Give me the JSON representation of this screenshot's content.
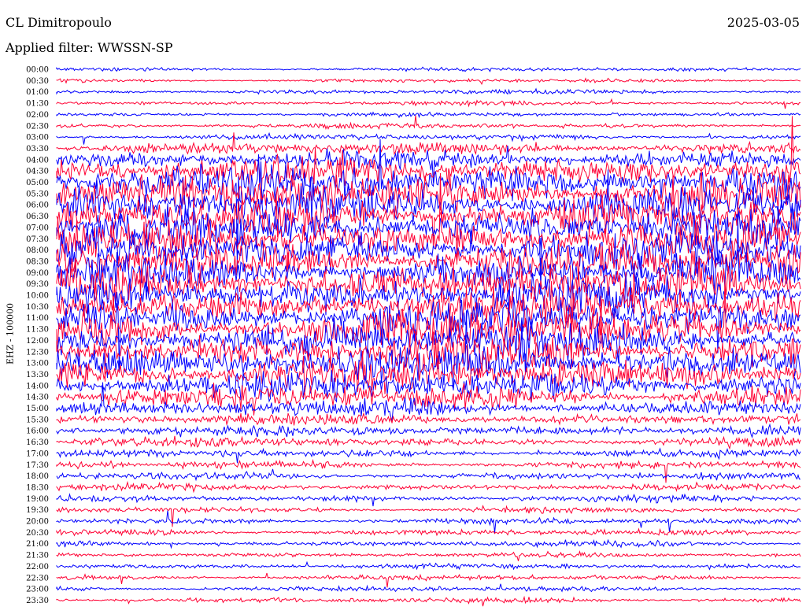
{
  "header": {
    "station": "CL Dimitropoulo",
    "date": "2025-03-05",
    "filter_label": "Applied filter: WWSSN-SP"
  },
  "chart_data": {
    "type": "helicorder",
    "title": "CL Dimitropoulo",
    "date": "2025-03-05",
    "filter": "WWSSN-SP",
    "ylabel": "EHZ - 100000",
    "row_labels": [
      "00:00",
      "00:30",
      "01:00",
      "01:30",
      "02:00",
      "02:30",
      "03:00",
      "03:30",
      "04:00",
      "04:30",
      "05:00",
      "05:30",
      "06:00",
      "06:30",
      "07:00",
      "07:30",
      "08:00",
      "08:30",
      "09:00",
      "09:30",
      "10:00",
      "10:30",
      "11:00",
      "11:30",
      "12:00",
      "12:30",
      "13:00",
      "13:30",
      "14:00",
      "14:30",
      "15:00",
      "15:30",
      "16:00",
      "16:30",
      "17:00",
      "17:30",
      "18:00",
      "18:30",
      "19:00",
      "19:30",
      "20:00",
      "20:30",
      "21:00",
      "21:30",
      "22:00",
      "22:30",
      "23:00",
      "23:30"
    ],
    "trace_colors": [
      "#0000ff",
      "#ff0033"
    ],
    "relative_amplitude": [
      0.25,
      0.25,
      0.3,
      0.3,
      0.3,
      0.35,
      0.4,
      0.8,
      1.2,
      2.0,
      2.5,
      2.6,
      2.6,
      2.6,
      2.6,
      2.6,
      2.6,
      2.6,
      2.6,
      2.6,
      2.6,
      2.6,
      2.6,
      2.6,
      2.6,
      2.6,
      2.6,
      2.4,
      2.1,
      1.6,
      1.1,
      0.8,
      0.7,
      0.6,
      0.55,
      0.5,
      0.5,
      0.45,
      0.45,
      0.4,
      0.4,
      0.4,
      0.4,
      0.35,
      0.35,
      0.35,
      0.35,
      0.35
    ],
    "grid": false
  }
}
